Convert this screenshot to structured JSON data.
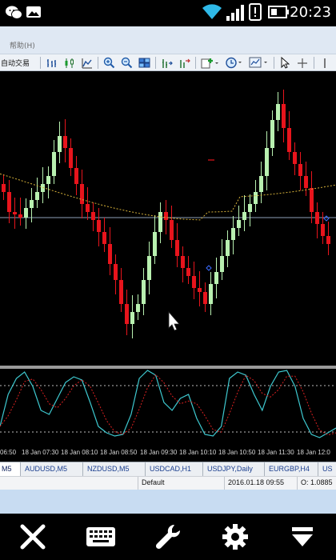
{
  "status_bar": {
    "time": "20:23",
    "icons": [
      "wechat-icon",
      "gallery-icon",
      "wifi-icon",
      "signal-icon",
      "alert-icon",
      "battery-icon"
    ]
  },
  "menu": {
    "help_label": "帮助(H)"
  },
  "toolbar": {
    "autotrade_label": "自动交易",
    "icons": [
      "bar-chart-icon",
      "candlestick-icon",
      "line-chart-icon",
      "zoom-in-icon",
      "zoom-out-icon",
      "tile-windows-icon",
      "chart-shift-icon",
      "autoscroll-icon",
      "indicators-icon",
      "periods-icon",
      "templates-icon",
      "cursor-icon",
      "crosshair-icon"
    ]
  },
  "chart": {
    "colors": {
      "bull": "#b8f0b0",
      "bear": "#e8141c",
      "ma": "#d7b23a",
      "stoch_main": "#3ec9d0",
      "stoch_signal": "#d82020",
      "levels": "#bdbdbd",
      "price_line": "#8ea0b8"
    }
  },
  "time_axis": {
    "labels": [
      "06:50",
      "18 Jan 07:30",
      "18 Jan 08:10",
      "18 Jan 08:50",
      "18 Jan 09:30",
      "18 Jan 10:10",
      "18 Jan 10:50",
      "18 Jan 11:30",
      "18 Jan 12:0"
    ]
  },
  "tabs": [
    {
      "label": "M5",
      "active": true
    },
    {
      "label": "AUDUSD,M5",
      "active": false
    },
    {
      "label": "NZDUSD,M5",
      "active": false
    },
    {
      "label": "USDCAD,H1",
      "active": false
    },
    {
      "label": "USDJPY,Daily",
      "active": false
    },
    {
      "label": "EURGBP,H4",
      "active": false
    },
    {
      "label": "US",
      "active": false
    }
  ],
  "mt_status": {
    "profile": "Default",
    "datetime": "2016.01.18 09:55",
    "ohlc": "O: 1.0885"
  },
  "nav_icons": [
    "close-icon",
    "keyboard-icon",
    "wrench-icon",
    "gear-icon",
    "dropdown-icon"
  ]
}
